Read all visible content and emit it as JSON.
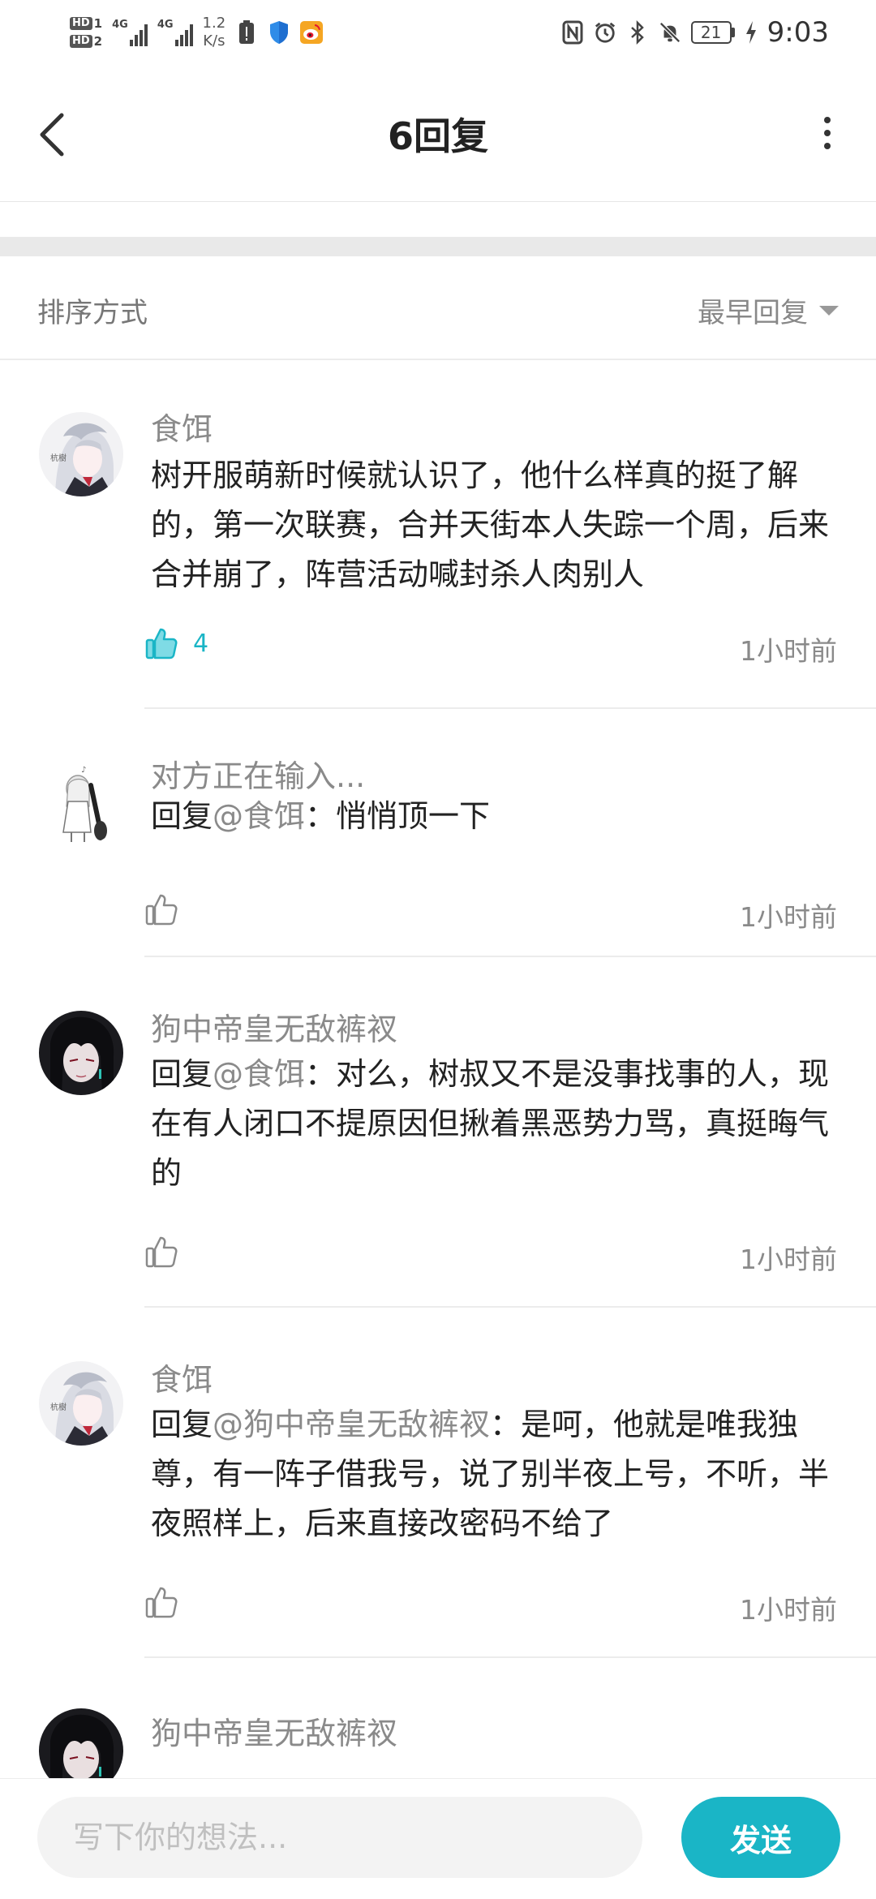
{
  "status_bar": {
    "hd1": "HD",
    "hd1_sim": "1",
    "hd2": "HD",
    "hd2_sim": "2",
    "net1": "4G",
    "net2": "4G",
    "speed_value": "1.2",
    "speed_unit": "K/s",
    "battery": "21",
    "time": "9:03"
  },
  "header": {
    "title": "6回复"
  },
  "sort": {
    "label": "排序方式",
    "selected": "最早回复"
  },
  "comments": [
    {
      "author": "食饵",
      "text": "树开服萌新时候就认识了，他什么样真的挺了解的，第一次联赛，合并天街本人失踪一个周，后来合并崩了，阵营活动喊封杀人肉别人",
      "likes": "4",
      "liked": true,
      "time": "1小时前"
    },
    {
      "author": "对方正在输入...",
      "reply_prefix": "回复",
      "reply_to": "@食饵",
      "text": "：悄悄顶一下",
      "time": "1小时前"
    },
    {
      "author": "狗中帝皇无敌裤衩",
      "reply_prefix": "回复",
      "reply_to": "@食饵",
      "text": "：对么，树叔又不是没事找事的人，现在有人闭口不提原因但揪着黑恶势力骂，真挺晦气的",
      "time": "1小时前"
    },
    {
      "author": "食饵",
      "reply_prefix": "回复",
      "reply_to": "@狗中帝皇无敌裤衩",
      "text": "：是呵，他就是唯我独尊，有一阵子借我号，说了别半夜上号，不听，半夜照样上，后来直接改密码不给了",
      "time": "1小时前"
    },
    {
      "author": "狗中帝皇无敌裤衩"
    }
  ],
  "input": {
    "placeholder": "写下你的想法...",
    "send_label": "发送"
  },
  "colors": {
    "accent": "#1ab5c6",
    "muted_text": "#8a8a8a",
    "divider": "#ececec"
  },
  "icons": {
    "back": "chevron-left-icon",
    "more": "more-vertical-icon",
    "like": "thumbs-up-icon",
    "sort_caret": "caret-down-icon"
  }
}
